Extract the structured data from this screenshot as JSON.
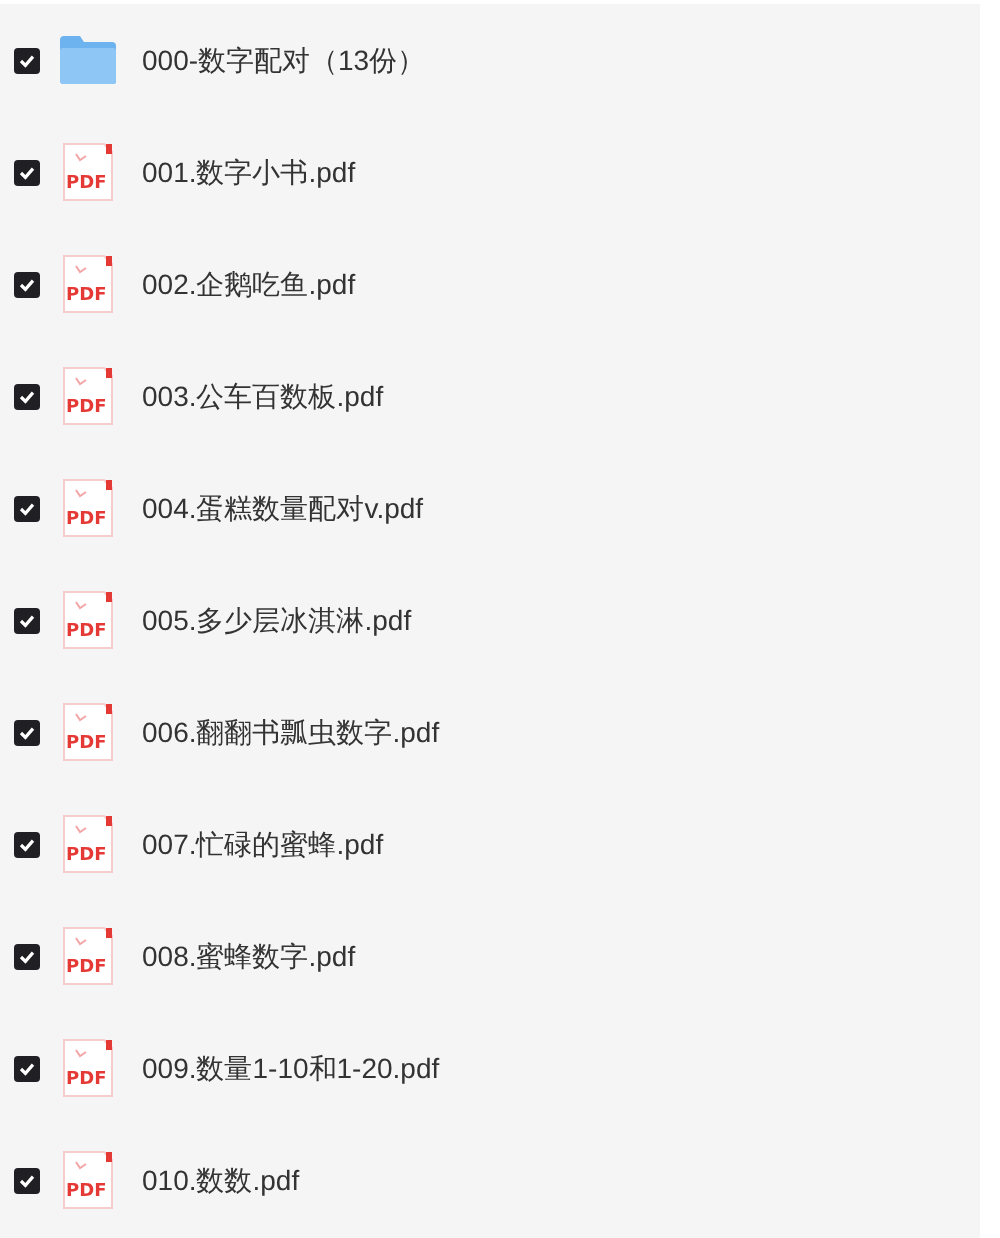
{
  "files": [
    {
      "kind": "folder",
      "name": "000-数字配对（13份）",
      "checked": true
    },
    {
      "kind": "pdf",
      "icon_label": "PDF",
      "name": "001.数字小书.pdf",
      "checked": true
    },
    {
      "kind": "pdf",
      "icon_label": "PDF",
      "name": "002.企鹅吃鱼.pdf",
      "checked": true
    },
    {
      "kind": "pdf",
      "icon_label": "PDF",
      "name": "003.公车百数板.pdf",
      "checked": true
    },
    {
      "kind": "pdf",
      "icon_label": "PDF",
      "name": "004.蛋糕数量配对v.pdf",
      "checked": true
    },
    {
      "kind": "pdf",
      "icon_label": "PDF",
      "name": "005.多少层冰淇淋.pdf",
      "checked": true
    },
    {
      "kind": "pdf",
      "icon_label": "PDF",
      "name": "006.翻翻书瓢虫数字.pdf",
      "checked": true
    },
    {
      "kind": "pdf",
      "icon_label": "PDF",
      "name": "007.忙碌的蜜蜂.pdf",
      "checked": true
    },
    {
      "kind": "pdf",
      "icon_label": "PDF",
      "name": "008.蜜蜂数字.pdf",
      "checked": true
    },
    {
      "kind": "pdf",
      "icon_label": "PDF",
      "name": "009.数量1-10和1-20.pdf",
      "checked": true
    },
    {
      "kind": "pdf",
      "icon_label": "PDF",
      "name": "010.数数.pdf",
      "checked": true
    }
  ]
}
